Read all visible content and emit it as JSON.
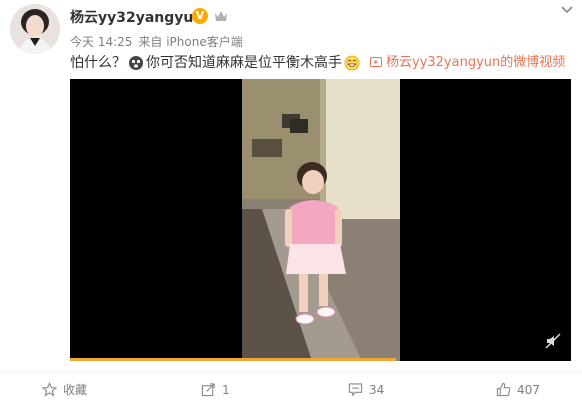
{
  "post": {
    "author": "杨云yy32yangyun",
    "verified_badge": "V",
    "time": "今天 14:25",
    "source": "来自 iPhone客户端",
    "text_before_emoji": "怕什么？",
    "text_after_emoji": "你可否知道麻麻是位平衡木高手",
    "video_link": "杨云yy32yangyun的微博视频"
  },
  "video": {
    "progress": 0.65
  },
  "actions": {
    "favorite_label": "收藏",
    "share_count": "1",
    "comment_count": "34",
    "like_count": "407"
  },
  "colors": {
    "link": "#eb7350",
    "badge": "#f7ab00",
    "progress": "#f2a832"
  },
  "icons": [
    "chevron-down-icon",
    "crown-icon",
    "surprised-emoji-icon",
    "grin-emoji-icon",
    "video-play-icon",
    "mute-icon",
    "star-icon",
    "share-icon",
    "comment-icon",
    "like-icon"
  ]
}
